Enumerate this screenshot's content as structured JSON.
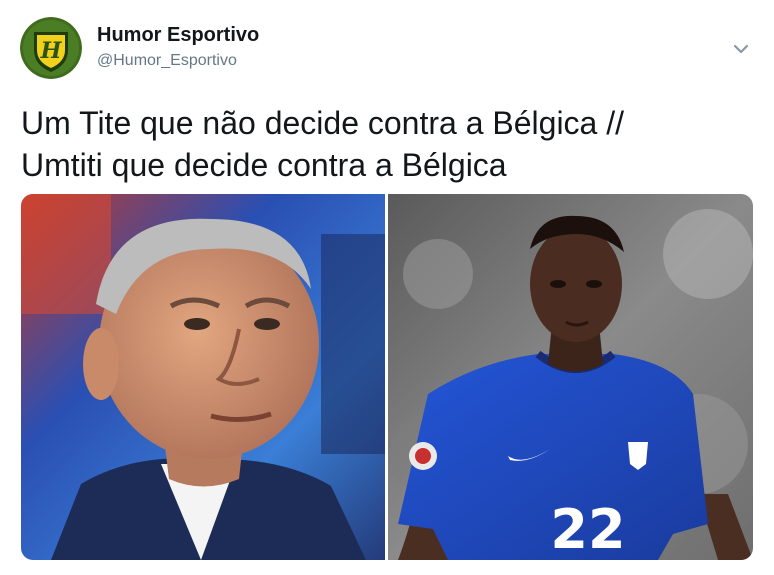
{
  "tweet": {
    "display_name": "Humor Esportivo",
    "handle": "@Humor_Esportivo",
    "text_lines": [
      "Um Tite que não decide contra a Bélgica //",
      "Umtiti que decide contra a Bélgica"
    ]
  },
  "avatar": {
    "monogram": "H",
    "icon": "club-shield-icon"
  },
  "media": {
    "photos": [
      {
        "icon": "photo-icon",
        "subject": "coach-portrait"
      },
      {
        "icon": "photo-icon",
        "subject": "player-portrait",
        "jersey_number": "22"
      }
    ]
  },
  "icons": {
    "menu": "chevron-down-icon"
  },
  "colors": {
    "text": "#14171a",
    "secondary": "#657786",
    "avatar_green": "#3f6b1e",
    "avatar_yellow": "#f1d11c",
    "jersey_blue": "#1f4fd1"
  }
}
